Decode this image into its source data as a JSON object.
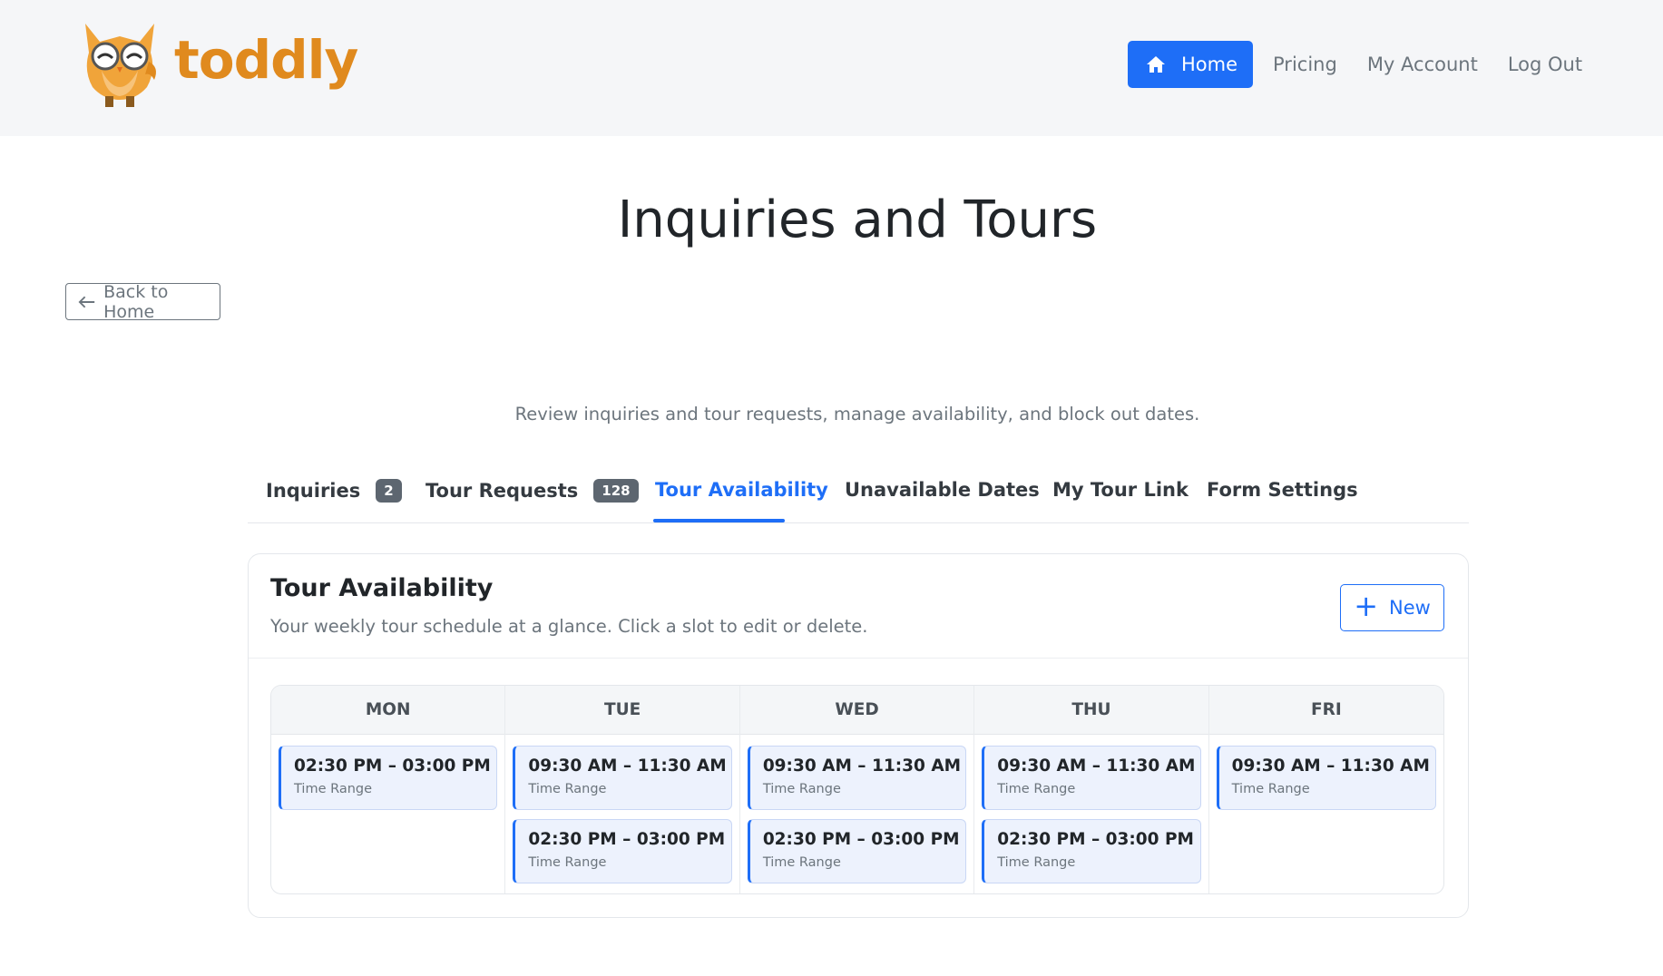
{
  "brand": {
    "name": "toddly",
    "logo_icon": "owl-logo-icon",
    "color": "#e08a1e"
  },
  "nav": {
    "home_label": "Home",
    "pricing_label": "Pricing",
    "account_label": "My Account",
    "logout_label": "Log Out",
    "accent": "#1e6ef7"
  },
  "page": {
    "title": "Inquiries and Tours",
    "back_label": "Back to Home",
    "subtitle": "Review inquiries and tour requests, manage availability, and block out dates."
  },
  "tabs": [
    {
      "label": "Inquiries",
      "badge": "2",
      "active": false
    },
    {
      "label": "Tour Requests",
      "badge": "128",
      "active": false
    },
    {
      "label": "Tour Availability",
      "badge": null,
      "active": true
    },
    {
      "label": "Unavailable Dates",
      "badge": null,
      "active": false
    },
    {
      "label": "My Tour Link",
      "badge": null,
      "active": false
    },
    {
      "label": "Form Settings",
      "badge": null,
      "active": false
    }
  ],
  "availability": {
    "title": "Tour Availability",
    "description": "Your weekly tour schedule at a glance. Click a slot to edit or delete.",
    "new_label": "New",
    "slot_label": "Time Range",
    "days": [
      {
        "name": "MON",
        "slots": [
          "02:30 PM – 03:00 PM"
        ]
      },
      {
        "name": "TUE",
        "slots": [
          "09:30 AM – 11:30 AM",
          "02:30 PM – 03:00 PM"
        ]
      },
      {
        "name": "WED",
        "slots": [
          "09:30 AM – 11:30 AM",
          "02:30 PM – 03:00 PM"
        ]
      },
      {
        "name": "THU",
        "slots": [
          "09:30 AM – 11:30 AM",
          "02:30 PM – 03:00 PM"
        ]
      },
      {
        "name": "FRI",
        "slots": [
          "09:30 AM – 11:30 AM"
        ]
      }
    ]
  }
}
